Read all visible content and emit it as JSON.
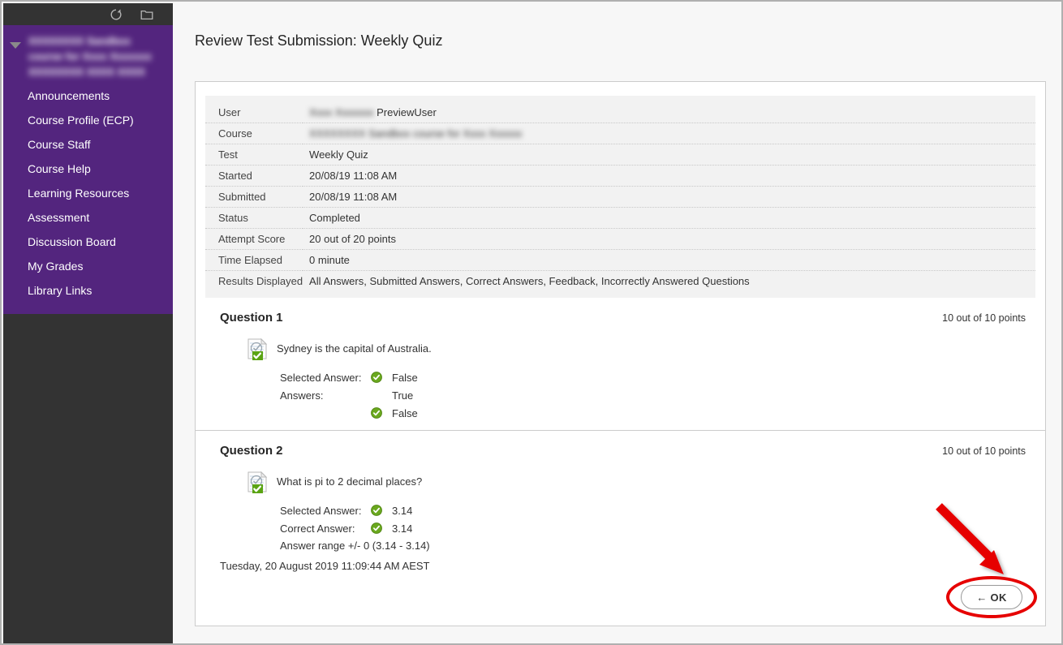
{
  "sidebar": {
    "toolbar": {
      "refresh_icon": "refresh-icon",
      "folder_icon": "folder-icon"
    },
    "course_title": "XXXXXXXX Sandbox course for Xxxx Xxxxxxx XXXXXXXX XXXX XXXX",
    "items": [
      {
        "label": "Announcements"
      },
      {
        "label": "Course Profile (ECP)"
      },
      {
        "label": "Course Staff"
      },
      {
        "label": "Course Help"
      },
      {
        "label": "Learning Resources"
      },
      {
        "label": "Assessment"
      },
      {
        "label": "Discussion Board"
      },
      {
        "label": "My Grades"
      },
      {
        "label": "Library Links"
      }
    ]
  },
  "page": {
    "title": "Review Test Submission: Weekly Quiz"
  },
  "info": {
    "rows": [
      {
        "label": "User",
        "value": "PreviewUser",
        "blurred_prefix": "Xxxx Xxxxxxx"
      },
      {
        "label": "Course",
        "value": "",
        "blurred_value": "XXXXXXXX Sandbox course for Xxxx Xxxxxx"
      },
      {
        "label": "Test",
        "value": "Weekly Quiz"
      },
      {
        "label": "Started",
        "value": "20/08/19 11:08 AM"
      },
      {
        "label": "Submitted",
        "value": "20/08/19 11:08 AM"
      },
      {
        "label": "Status",
        "value": "Completed"
      },
      {
        "label": "Attempt Score",
        "value": "20 out of 20 points"
      },
      {
        "label": "Time Elapsed",
        "value": "0 minute"
      },
      {
        "label": "Results Displayed",
        "value": "All Answers, Submitted Answers, Correct Answers, Feedback, Incorrectly Answered Questions"
      }
    ]
  },
  "questions": [
    {
      "title": "Question 1",
      "points": "10 out of 10 points",
      "icon": "question-correct-icon",
      "stem": "Sydney is the capital of Australia.",
      "rows": [
        {
          "label": "Selected Answer:",
          "mark": "correct-check-icon",
          "text": "False"
        },
        {
          "label": "Answers:",
          "mark": "",
          "text": "True"
        },
        {
          "label": "",
          "mark": "correct-check-icon",
          "text": "False"
        }
      ]
    },
    {
      "title": "Question 2",
      "points": "10 out of 10 points",
      "icon": "question-correct-icon",
      "stem": "What is pi to 2 decimal places?",
      "rows": [
        {
          "label": "Selected Answer:",
          "mark": "correct-check-icon",
          "text": "3.14"
        },
        {
          "label": "Correct Answer:",
          "mark": "correct-check-icon",
          "text": "3.14"
        },
        {
          "label": "",
          "mark": "",
          "text": "Answer range +/- 0 (3.14 - 3.14)"
        }
      ]
    }
  ],
  "timestamp": "Tuesday, 20 August 2019 11:09:44 AM AEST",
  "footer": {
    "ok_label": "← OK"
  },
  "colors": {
    "sidebar_purple": "#53257e",
    "sidebar_dark": "#333333",
    "annotation_red": "#e60000",
    "correct_green": "#6aa81e"
  }
}
